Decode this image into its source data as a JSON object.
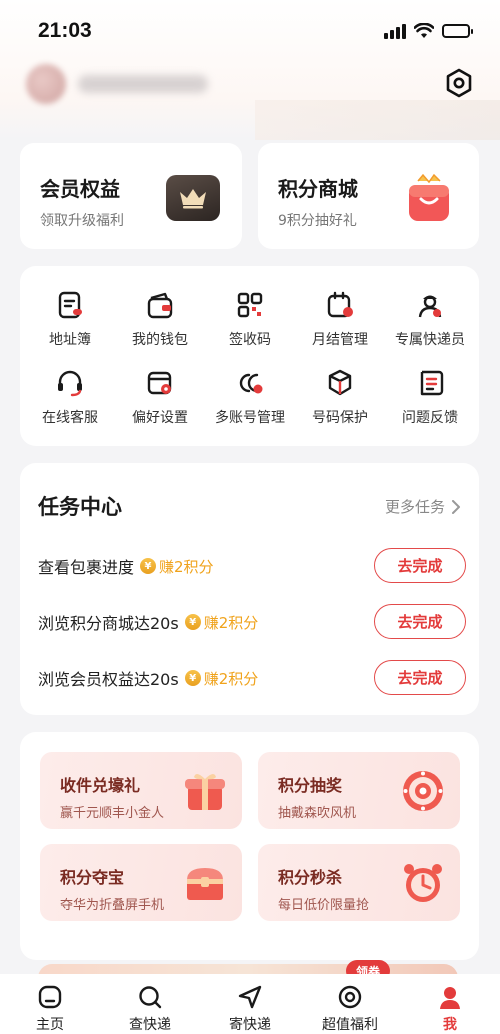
{
  "status_bar": {
    "time": "21:03"
  },
  "cards": {
    "membership": {
      "title": "会员权益",
      "subtitle": "领取升级福利"
    },
    "mall": {
      "title": "积分商城",
      "subtitle": "9积分抽好礼"
    }
  },
  "services": [
    {
      "label": "地址簿",
      "icon": "address-book-icon"
    },
    {
      "label": "我的钱包",
      "icon": "wallet-icon"
    },
    {
      "label": "签收码",
      "icon": "qr-code-icon"
    },
    {
      "label": "月结管理",
      "icon": "calendar-settle-icon"
    },
    {
      "label": "专属快递员",
      "icon": "courier-icon"
    },
    {
      "label": "在线客服",
      "icon": "headset-icon"
    },
    {
      "label": "偏好设置",
      "icon": "preference-icon"
    },
    {
      "label": "多账号管理",
      "icon": "multi-account-icon"
    },
    {
      "label": "号码保护",
      "icon": "shield-box-icon"
    },
    {
      "label": "问题反馈",
      "icon": "feedback-icon"
    }
  ],
  "task_center": {
    "title": "任务中心",
    "more": "更多任务",
    "tasks": [
      {
        "name": "查看包裹进度",
        "reward": "赚2积分",
        "action": "去完成"
      },
      {
        "name": "浏览积分商城达20s",
        "reward": "赚2积分",
        "action": "去完成"
      },
      {
        "name": "浏览会员权益达20s",
        "reward": "赚2积分",
        "action": "去完成"
      }
    ]
  },
  "promos": [
    {
      "title": "收件兑壕礼",
      "subtitle": "赢千元顺丰小金人",
      "icon": "gift-box-icon"
    },
    {
      "title": "积分抽奖",
      "subtitle": "抽戴森吹风机",
      "icon": "lottery-wheel-icon"
    },
    {
      "title": "积分夺宝",
      "subtitle": "夺华为折叠屏手机",
      "icon": "treasure-chest-icon"
    },
    {
      "title": "积分秒杀",
      "subtitle": "每日低价限量抢",
      "icon": "alarm-clock-icon"
    }
  ],
  "coupon_tag": "领券",
  "tabs": [
    {
      "label": "主页",
      "icon": "home-icon"
    },
    {
      "label": "查快递",
      "icon": "search-icon"
    },
    {
      "label": "寄快递",
      "icon": "send-icon"
    },
    {
      "label": "超值福利",
      "icon": "benefit-icon"
    },
    {
      "label": "我",
      "icon": "profile-icon",
      "active": true
    }
  ],
  "colors": {
    "accent": "#e33b3b",
    "reward": "#f0a31c",
    "background": "#f4f4f6"
  }
}
